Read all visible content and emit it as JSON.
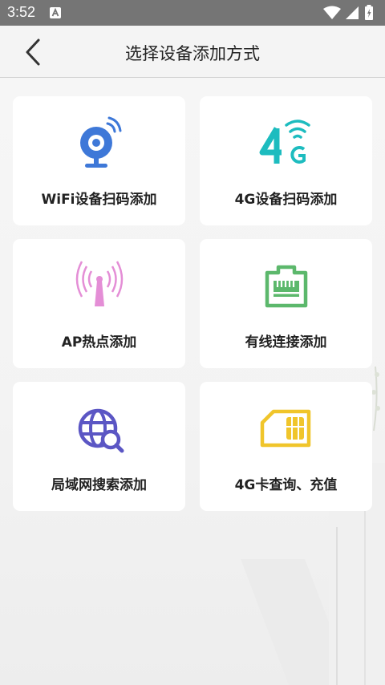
{
  "status_bar": {
    "time": "3:52",
    "icons": [
      "accessibility-a-icon",
      "wifi-icon",
      "signal-icon",
      "battery-icon"
    ]
  },
  "header": {
    "title": "选择设备添加方式",
    "back_icon": "chevron-left-icon"
  },
  "options": [
    {
      "label": "WiFi设备扫码添加",
      "icon": "wifi-camera-icon",
      "color": "#3e78d8"
    },
    {
      "label": "4G设备扫码添加",
      "icon": "4g-signal-icon",
      "color": "#1dbcbf"
    },
    {
      "label": "AP热点添加",
      "icon": "antenna-hotspot-icon",
      "color": "#e48ed6"
    },
    {
      "label": "有线连接添加",
      "icon": "ethernet-port-icon",
      "color": "#5cb86c"
    },
    {
      "label": "局域网搜索添加",
      "icon": "globe-search-icon",
      "color": "#5b56c4"
    },
    {
      "label": "4G卡查询、充值",
      "icon": "sim-card-icon",
      "color": "#f0c52b"
    }
  ],
  "colors": {
    "status_bar": "#757575",
    "header_bg": "#f4f4f4",
    "card_bg": "#ffffff"
  }
}
